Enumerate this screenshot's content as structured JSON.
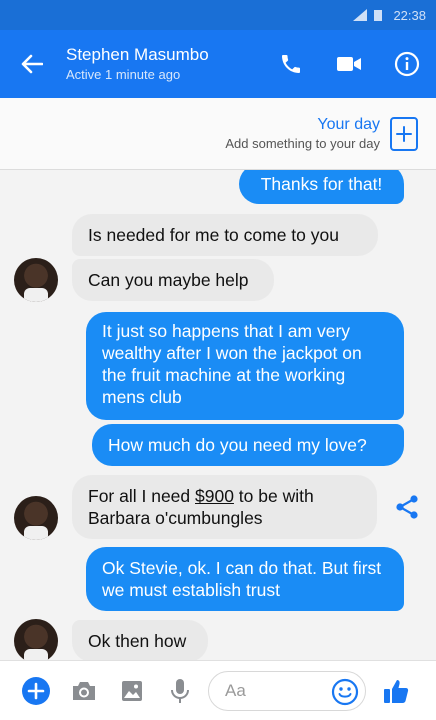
{
  "status_bar": {
    "time": "22:38"
  },
  "header": {
    "contact_name": "Stephen Masumbo",
    "contact_status": "Active 1 minute ago"
  },
  "your_day": {
    "title": "Your day",
    "subtitle": "Add something to your day"
  },
  "messages": [
    {
      "direction": "outgoing",
      "text": "Thanks for that!"
    },
    {
      "direction": "incoming",
      "text": "Is needed for me to come to you"
    },
    {
      "direction": "incoming",
      "text": "Can you maybe help"
    },
    {
      "direction": "outgoing",
      "text": "It just so happens that I am very wealthy after I won the jackpot on the fruit machine at the working mens club"
    },
    {
      "direction": "outgoing",
      "text": "How much do you need my love?"
    },
    {
      "direction": "incoming",
      "text_before": "For all I need ",
      "amount": "$900",
      "text_after": " to be with Barbara o'cumbungles"
    },
    {
      "direction": "outgoing",
      "text": "Ok Stevie, ok. I can do that. But first we must establish trust"
    },
    {
      "direction": "incoming",
      "text": "Ok then how"
    }
  ],
  "composer": {
    "placeholder": "Aa"
  },
  "colors": {
    "header_bg": "#1877f2",
    "outgoing_bubble": "#1a8cf5",
    "incoming_bubble": "#e9e9e9",
    "accent": "#1877f2"
  },
  "icons": [
    "back-arrow-icon",
    "phone-icon",
    "video-camera-icon",
    "info-icon",
    "plus-icon",
    "share-icon",
    "camera-icon",
    "image-icon",
    "microphone-icon",
    "emoji-icon",
    "thumbs-up-icon"
  ]
}
